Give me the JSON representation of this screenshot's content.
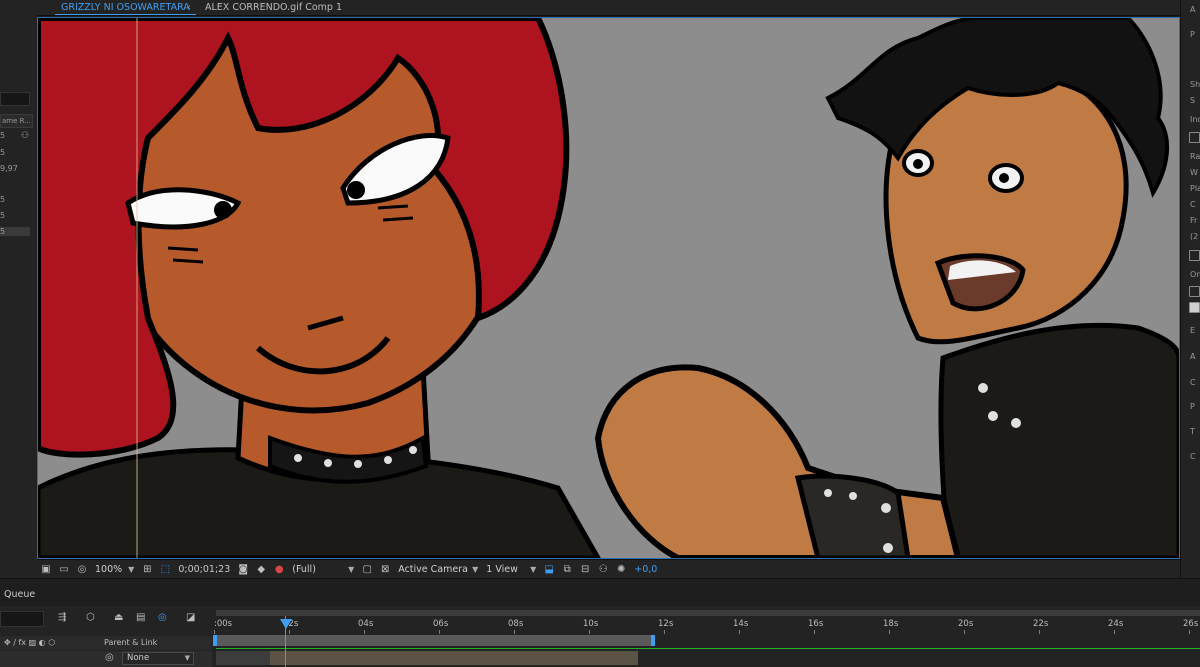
{
  "left_panel": {
    "header_label": "ame R...",
    "values": [
      "5",
      "5",
      "9,97",
      "5",
      "5",
      "5"
    ]
  },
  "tabs": {
    "active": "GRIZZLY NI OSOWARETARA",
    "separator": "‹",
    "inactive": "ALEX CORRENDO.gif Comp 1"
  },
  "viewer_toolbar": {
    "zoom": "100%",
    "timecode": "0;00;01;23",
    "resolution": "(Full)",
    "camera": "Active Camera",
    "view": "1 View",
    "exposure": "+0,0"
  },
  "right_panel": {
    "labels": [
      "A",
      "P",
      "Sh",
      "S",
      "Inc",
      "Ra",
      "W",
      "Pla",
      "C",
      "Fr",
      "(2",
      "On",
      "E",
      "A",
      "C",
      "P",
      "T",
      "C"
    ]
  },
  "timeline": {
    "panel_label": "Queue",
    "ruler_labels": [
      ":00s",
      "02s",
      "04s",
      "06s",
      "08s",
      "10s",
      "12s",
      "14s",
      "16s",
      "18s",
      "20s",
      "22s",
      "24s",
      "26s"
    ],
    "column_header": "Parent & Link",
    "layer_parent_value": "None"
  },
  "colors": {
    "accent_blue": "#3f9ef2",
    "work_area_green": "#21b32b",
    "canvas_gray": "#8d8d8d"
  },
  "icons": [
    "camera-icon",
    "color-channel-icon",
    "transparency-grid-icon",
    "region-of-interest-icon",
    "3d-view-icon",
    "fast-preview-icon",
    "exposure-reset-icon",
    "comp-flowchart-icon",
    "motion-blur-icon",
    "graph-editor-icon"
  ]
}
